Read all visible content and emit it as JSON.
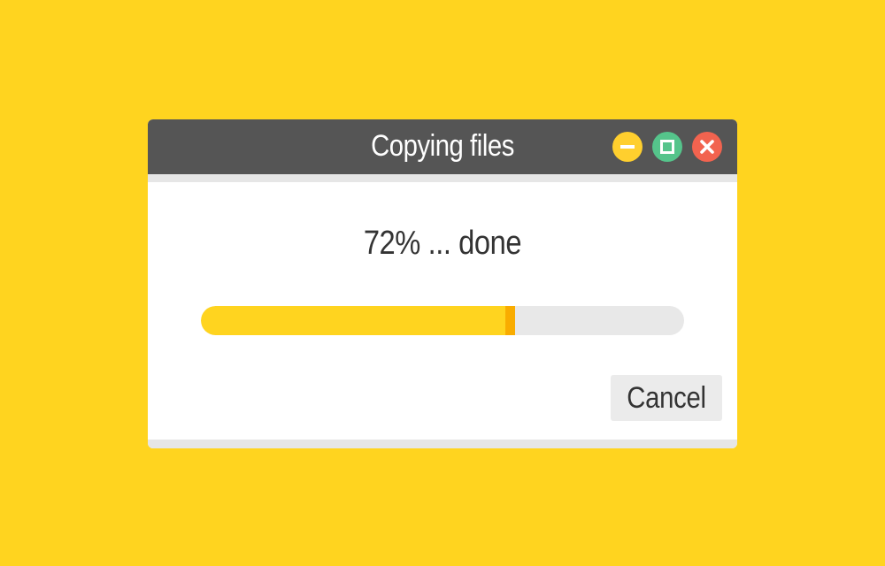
{
  "dialog": {
    "title": "Copying files",
    "status_text": "72% ... done",
    "progress": 0.65,
    "cancel_label": "Cancel"
  },
  "window_controls": {
    "minimize_icon": "minimize-icon",
    "maximize_icon": "maximize-icon",
    "close_icon": "close-icon"
  },
  "colors": {
    "background": "#FFD41F",
    "titlebar": "#555555",
    "progress_fill": "#FFD41F",
    "progress_cap": "#F9AC00",
    "progress_track": "#E8E8E8",
    "minimize": "#FFCF2E",
    "maximize": "#55C48B",
    "close": "#F2634F"
  }
}
